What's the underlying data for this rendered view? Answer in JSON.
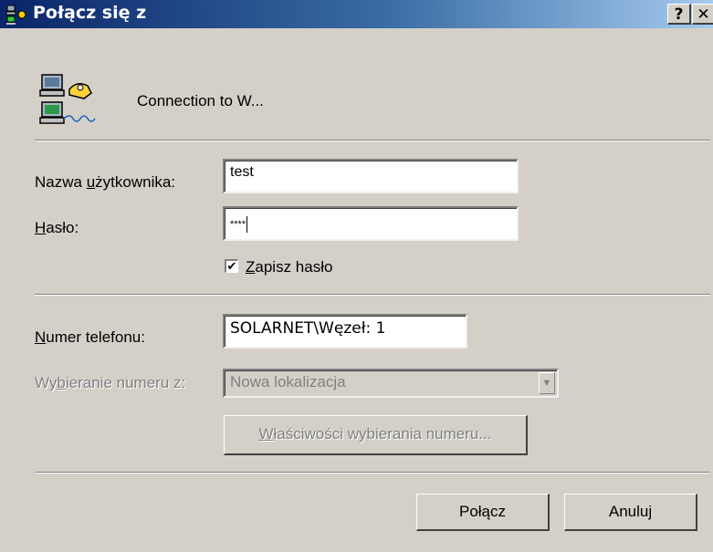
{
  "window": {
    "title": "Połącz się z",
    "help_label": "?",
    "close_label": "✕"
  },
  "header": {
    "connection_name": "Connection to W...",
    "icon": "dial-up-connection-icon"
  },
  "form": {
    "username": {
      "label_before": "Nazwa ",
      "label_accel": "u",
      "label_after": "żytkownika:",
      "value": "test"
    },
    "password": {
      "label_accel": "H",
      "label_after": "asło:",
      "value": "****"
    },
    "save_password": {
      "checked": true,
      "label_accel": "Z",
      "label_after": "apisz hasło",
      "check_mark": "✔"
    },
    "phone": {
      "label_accel": "N",
      "label_after": "umer telefonu:",
      "value": "SOLARNET\\Węzeł: 1"
    },
    "dial_from": {
      "label_before": "Wy",
      "label_accel": "b",
      "label_after": "ieranie numeru z:",
      "value": "Nowa lokalizacja",
      "enabled": false
    },
    "dialing_properties": {
      "label_accel": "W",
      "label_after": "łaściwości wybierania numeru...",
      "enabled": false
    }
  },
  "actions": {
    "connect_label": "Połącz",
    "cancel_label": "Anuluj"
  },
  "colors": {
    "titlebar_start": "#0a246a",
    "titlebar_end": "#a6caf0",
    "face": "#d4d0c8"
  }
}
